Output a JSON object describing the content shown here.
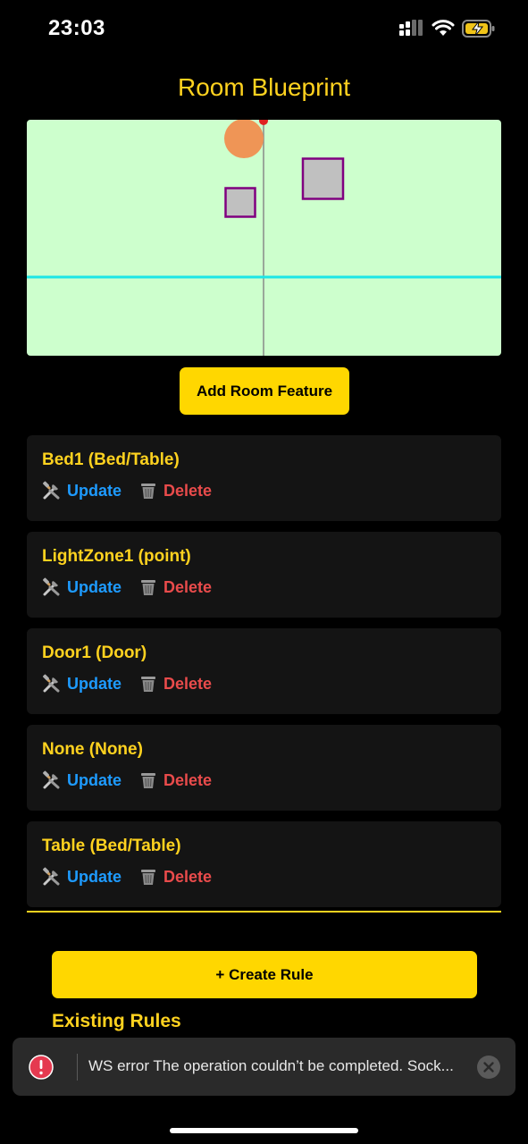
{
  "status_bar": {
    "time": "23:03"
  },
  "page_title": "Room Blueprint",
  "add_feature_label": "Add Room Feature",
  "features": [
    {
      "title": "Bed1 (Bed/Table)",
      "update": "Update",
      "delete": "Delete"
    },
    {
      "title": "LightZone1 (point)",
      "update": "Update",
      "delete": "Delete"
    },
    {
      "title": "Door1 (Door)",
      "update": "Update",
      "delete": "Delete"
    },
    {
      "title": "None (None)",
      "update": "Update",
      "delete": "Delete"
    },
    {
      "title": "Table (Bed/Table)",
      "update": "Update",
      "delete": "Delete"
    }
  ],
  "create_rule_label": "+ Create Rule",
  "rules_title": "Existing Rules",
  "toast": {
    "message": "WS error The operation couldn’t be completed. Sock..."
  },
  "colors": {
    "accent": "#FFD21F",
    "button": "#FFD700",
    "update": "#1E9BFF",
    "delete": "#E94B4B",
    "blueprint_bg": "#CDFFCD"
  }
}
